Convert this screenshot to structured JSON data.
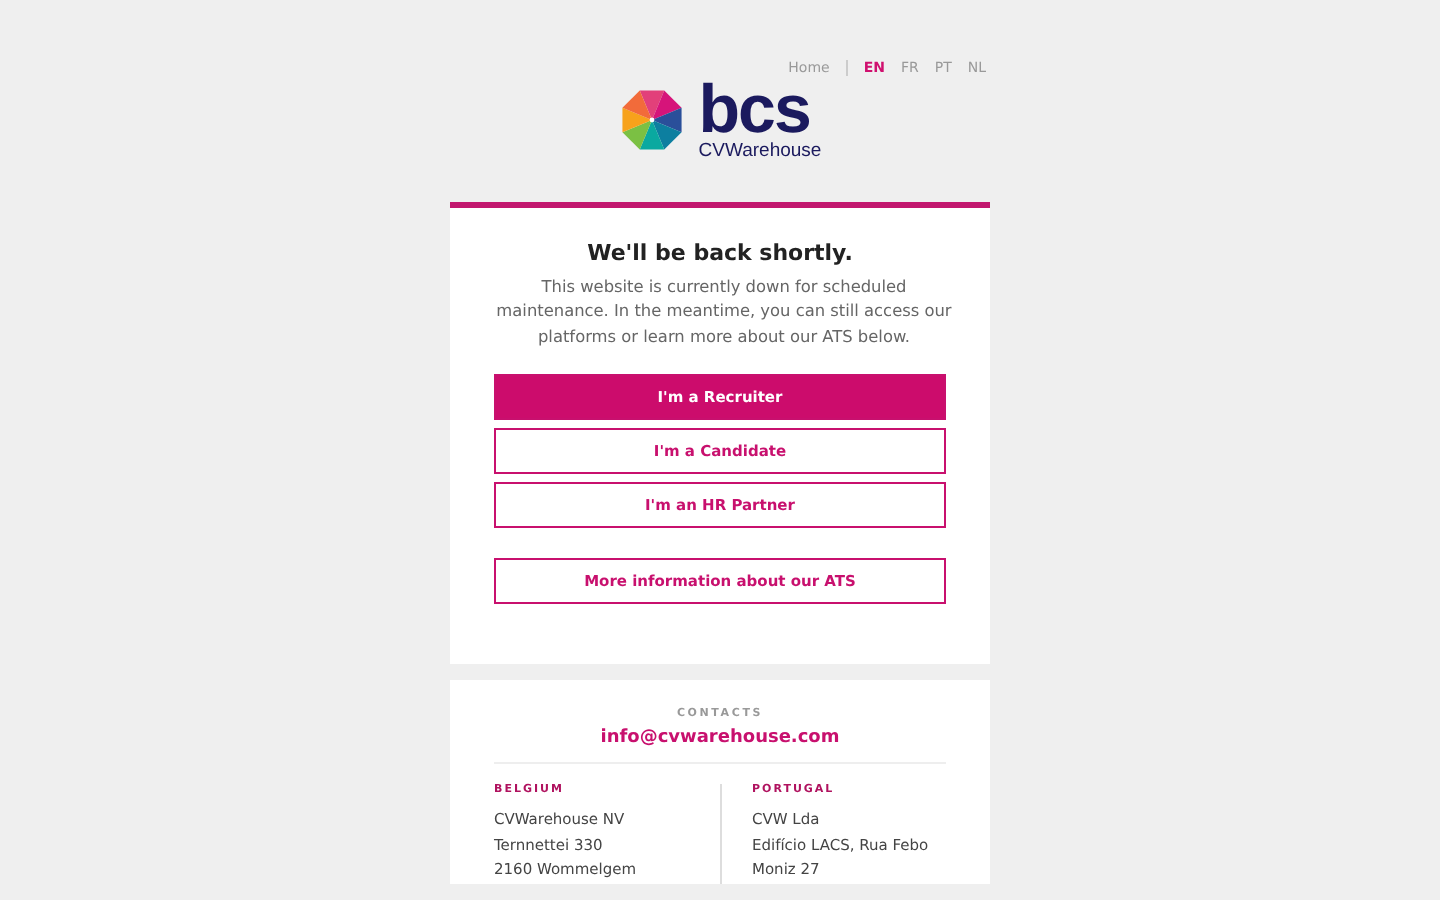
{
  "nav": {
    "home": "Home",
    "languages": [
      {
        "label": "EN",
        "selected": true
      },
      {
        "label": "FR",
        "selected": false
      },
      {
        "label": "PT",
        "selected": false
      },
      {
        "label": "NL",
        "selected": false
      }
    ]
  },
  "logo": {
    "wordmark": "bcs",
    "subtitle": "CVWarehouse"
  },
  "notice": {
    "title": "We'll be back shortly.",
    "message": "This website is currently down for scheduled maintenance. In the meantime, you can still access our platforms or learn more about our ATS below."
  },
  "buttons": [
    {
      "label": "I'm a Recruiter",
      "kind": "primary"
    },
    {
      "label": "I'm a Candidate",
      "kind": "outline"
    },
    {
      "label": "I'm an HR Partner",
      "kind": "outline"
    },
    {
      "label": "More information about our ATS",
      "kind": "outline-spaced"
    }
  ],
  "contacts": {
    "heading": "CONTACTS",
    "email": "info@cvwarehouse.com",
    "offices": [
      {
        "country": "BELGIUM",
        "lines": [
          "CVWarehouse NV",
          "Ternnettei 330",
          "2160 Wommelgem"
        ]
      },
      {
        "country": "PORTUGAL",
        "lines": [
          "CVW Lda",
          "Edifício LACS, Rua Febo",
          "Moniz 27"
        ]
      }
    ]
  }
}
